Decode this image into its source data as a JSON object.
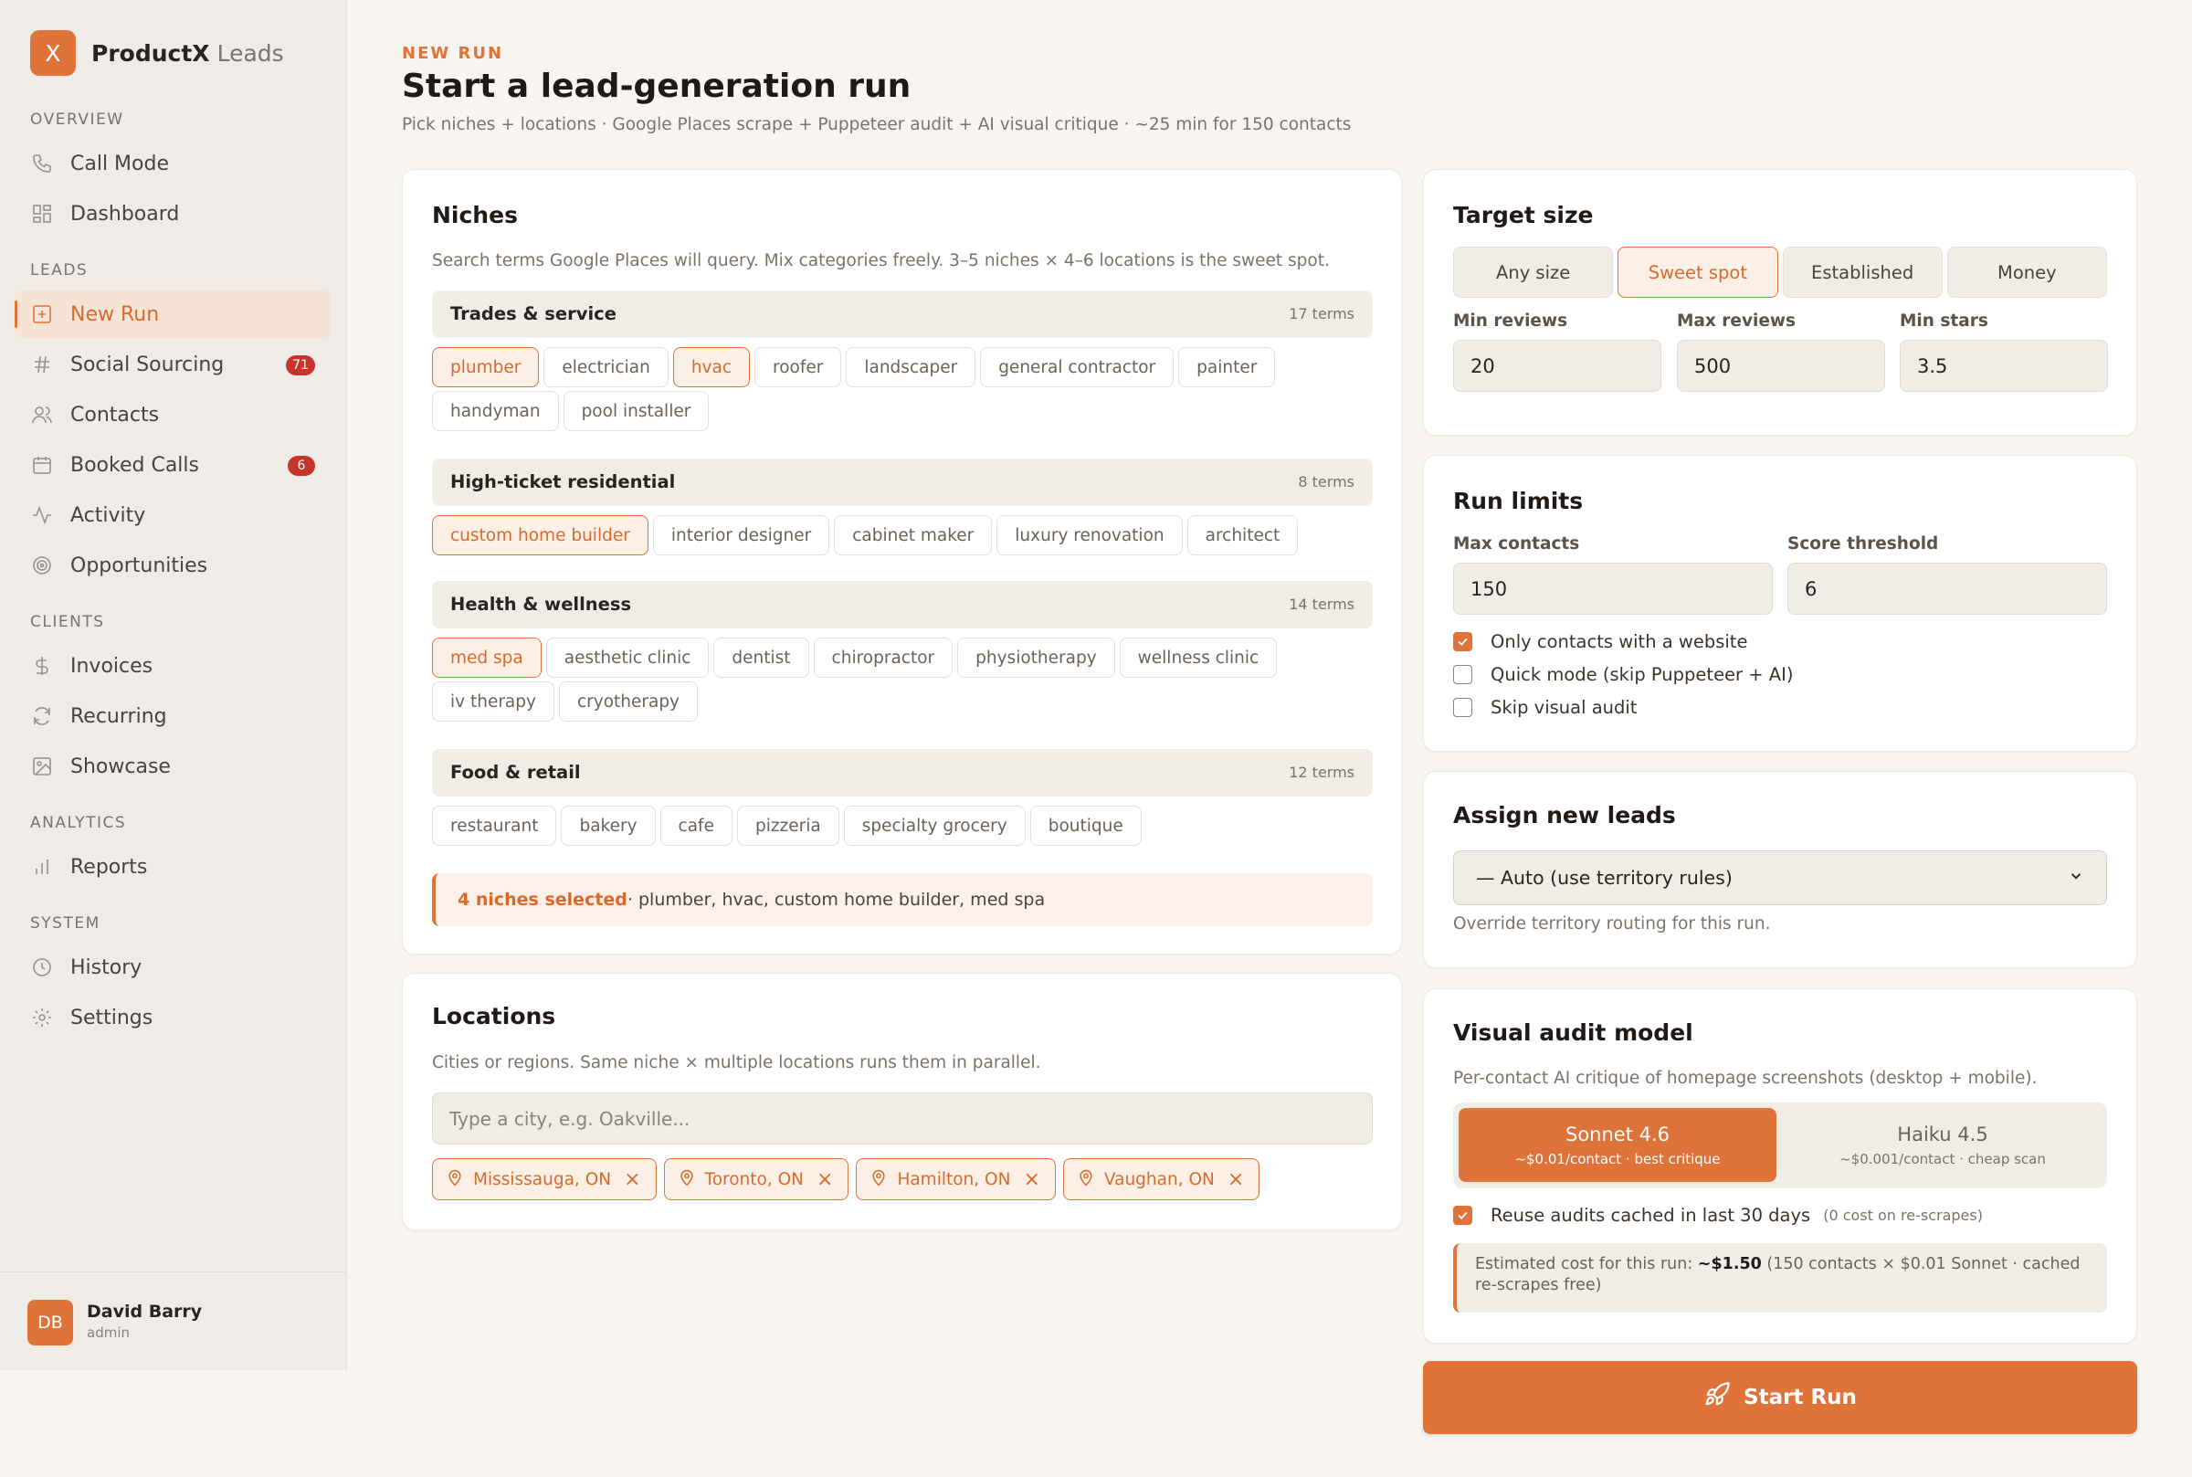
{
  "brand": {
    "logo_letter": "X",
    "name": "ProductX",
    "sub": "Leads"
  },
  "sidebar": {
    "sections": [
      {
        "label": "OVERVIEW",
        "items": [
          {
            "label": "Call Mode",
            "icon": "phone-icon"
          },
          {
            "label": "Dashboard",
            "icon": "dashboard-icon"
          }
        ]
      },
      {
        "label": "LEADS",
        "items": [
          {
            "label": "New Run",
            "icon": "plus-square-icon",
            "active": true
          },
          {
            "label": "Social Sourcing",
            "icon": "hash-icon",
            "badge": "71"
          },
          {
            "label": "Contacts",
            "icon": "users-icon"
          },
          {
            "label": "Booked Calls",
            "icon": "calendar-icon",
            "badge": "6"
          },
          {
            "label": "Activity",
            "icon": "activity-icon"
          },
          {
            "label": "Opportunities",
            "icon": "target-icon"
          }
        ]
      },
      {
        "label": "CLIENTS",
        "items": [
          {
            "label": "Invoices",
            "icon": "dollar-icon"
          },
          {
            "label": "Recurring",
            "icon": "refresh-icon"
          },
          {
            "label": "Showcase",
            "icon": "image-icon"
          }
        ]
      },
      {
        "label": "ANALYTICS",
        "items": [
          {
            "label": "Reports",
            "icon": "bar-chart-icon"
          }
        ]
      },
      {
        "label": "SYSTEM",
        "items": [
          {
            "label": "History",
            "icon": "clock-icon"
          },
          {
            "label": "Settings",
            "icon": "gear-icon"
          }
        ]
      }
    ],
    "user": {
      "initials": "DB",
      "name": "David Barry",
      "role": "admin"
    }
  },
  "header": {
    "eyebrow": "NEW RUN",
    "title": "Start a lead-generation run",
    "subtitle": "Pick niches + locations · Google Places scrape + Puppeteer audit + AI visual critique · ~25 min for 150 contacts"
  },
  "niches": {
    "title": "Niches",
    "description": "Search terms Google Places will query. Mix categories freely. 3–5 niches × 4–6 locations is the sweet spot.",
    "groups": [
      {
        "name": "Trades & service",
        "count": "17 terms",
        "terms": [
          {
            "label": "plumber",
            "selected": true
          },
          {
            "label": "electrician"
          },
          {
            "label": "hvac",
            "selected": true
          },
          {
            "label": "roofer"
          },
          {
            "label": "landscaper"
          },
          {
            "label": "general contractor"
          },
          {
            "label": "painter"
          },
          {
            "label": "handyman"
          },
          {
            "label": "pool installer"
          }
        ]
      },
      {
        "name": "High-ticket residential",
        "count": "8 terms",
        "terms": [
          {
            "label": "custom home builder",
            "selected": true
          },
          {
            "label": "interior designer"
          },
          {
            "label": "cabinet maker"
          },
          {
            "label": "luxury renovation"
          },
          {
            "label": "architect"
          }
        ]
      },
      {
        "name": "Health & wellness",
        "count": "14 terms",
        "terms": [
          {
            "label": "med spa",
            "selected": true
          },
          {
            "label": "aesthetic clinic"
          },
          {
            "label": "dentist"
          },
          {
            "label": "chiropractor"
          },
          {
            "label": "physiotherapy"
          },
          {
            "label": "wellness clinic"
          },
          {
            "label": "iv therapy"
          },
          {
            "label": "cryotherapy"
          }
        ]
      },
      {
        "name": "Food & retail",
        "count": "12 terms",
        "terms": [
          {
            "label": "restaurant"
          },
          {
            "label": "bakery"
          },
          {
            "label": "cafe"
          },
          {
            "label": "pizzeria"
          },
          {
            "label": "specialty grocery"
          },
          {
            "label": "boutique"
          }
        ]
      }
    ],
    "summary_count": "4 niches selected",
    "summary_list": " · plumber, hvac, custom home builder, med spa"
  },
  "locations": {
    "title": "Locations",
    "description": "Cities or regions. Same niche × multiple locations runs them in parallel.",
    "placeholder": "Type a city, e.g. Oakville...",
    "items": [
      "Mississauga, ON",
      "Toronto, ON",
      "Hamilton, ON",
      "Vaughan, ON"
    ]
  },
  "target": {
    "title": "Target size",
    "options": [
      {
        "label": "Any size"
      },
      {
        "label": "Sweet spot",
        "selected": true
      },
      {
        "label": "Established"
      },
      {
        "label": "Money"
      }
    ],
    "min_reviews_label": "Min reviews",
    "min_reviews": "20",
    "max_reviews_label": "Max reviews",
    "max_reviews": "500",
    "min_stars_label": "Min stars",
    "min_stars": "3.5"
  },
  "limits": {
    "title": "Run limits",
    "max_contacts_label": "Max contacts",
    "max_contacts": "150",
    "score_label": "Score threshold",
    "score": "6",
    "options": [
      {
        "label": "Only contacts with a website",
        "checked": true
      },
      {
        "label": "Quick mode (skip Puppeteer + AI)",
        "checked": false
      },
      {
        "label": "Skip visual audit",
        "checked": false
      }
    ]
  },
  "assign": {
    "title": "Assign new leads",
    "selected": "— Auto (use territory rules)",
    "help": "Override territory routing for this run."
  },
  "model": {
    "title": "Visual audit model",
    "description": "Per-contact AI critique of homepage screenshots (desktop + mobile).",
    "options": [
      {
        "name": "Sonnet 4.6",
        "detail": "~$0.01/contact · best critique",
        "selected": true
      },
      {
        "name": "Haiku 4.5",
        "detail": "~$0.001/contact · cheap scan"
      }
    ],
    "reuse_label": "Reuse audits cached in last 30 days",
    "reuse_note": "(0 cost on re-scrapes)",
    "estimate_prefix": "Estimated cost for this run: ",
    "estimate_value": "~$1.50",
    "estimate_suffix": " (150 contacts × $0.01 Sonnet · cached re-scrapes free)"
  },
  "start_label": "Start Run",
  "colors": {
    "accent": "#e0733a",
    "badge": "#c5352b"
  }
}
